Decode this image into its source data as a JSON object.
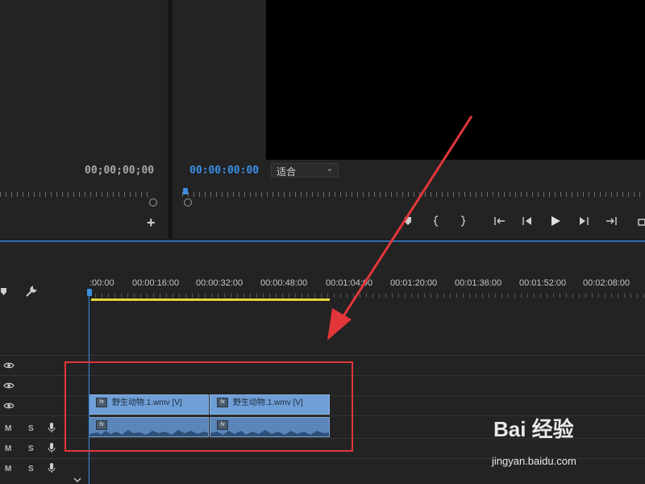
{
  "source_monitor": {
    "timecode": "00;00;00;00",
    "add_button": "+"
  },
  "program_monitor": {
    "timecode": "00:00:00:00",
    "fit_dropdown": "适合",
    "controls": [
      "mark-in",
      "mark-out",
      "go-to-in",
      "step-back",
      "play",
      "step-forward",
      "go-to-out",
      "lift"
    ]
  },
  "timeline": {
    "timecodes": [
      ":00:00",
      "00:00:16:00",
      "00:00:32:00",
      "00:00:48:00",
      "00:01:04:00",
      "00:01:20:00",
      "00:01:36:00",
      "00:01:52:00",
      "00:02:08:00"
    ],
    "tracks": {
      "audio_controls": {
        "mute": "M",
        "solo": "S"
      }
    },
    "video_clips": [
      {
        "label": "野生动物.1.wmv [V]",
        "fx": "fx"
      },
      {
        "label": "野生动物.1.wmv [V]",
        "fx": "fx"
      }
    ],
    "audio_clips": [
      {
        "fx": "fx"
      },
      {
        "fx": "fx"
      }
    ]
  },
  "colors": {
    "accent_blue": "#3b8fe4",
    "clip_blue": "#6f9fd7",
    "work_area_yellow": "#e5d63c",
    "annotation_red": "#e2363a"
  },
  "watermark": {
    "brand": "Bai 经验",
    "url": "jingyan.baidu.com"
  }
}
